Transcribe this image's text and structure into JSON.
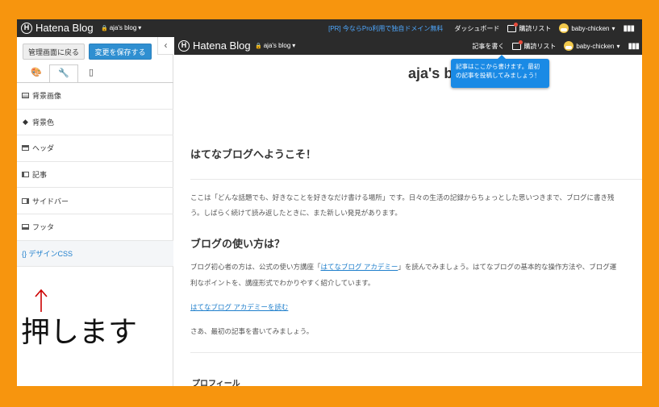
{
  "topbar": {
    "logo_text": "Hatena Blog",
    "blog_name": "aja's blog",
    "pr_text": "[PR] 今ならPro利用で独自ドメイン無料",
    "dashboard": "ダッシュボード",
    "reading_list": "購読リスト",
    "user": "baby-chicken"
  },
  "sidebar": {
    "back_button": "管理画面に戻る",
    "save_button": "変更を保存する",
    "collapse_glyph": "‹",
    "tabs": [
      {
        "icon": "palette-icon",
        "glyph": "🎨"
      },
      {
        "icon": "wrench-icon",
        "glyph": "🔧"
      },
      {
        "icon": "mobile-icon",
        "glyph": "▯"
      }
    ],
    "items": [
      {
        "label": "背景画像"
      },
      {
        "label": "背景色"
      },
      {
        "label": "ヘッダ"
      },
      {
        "label": "記事"
      },
      {
        "label": "サイドバー"
      },
      {
        "label": "フッタ"
      },
      {
        "label": "{} デザインCSS"
      }
    ],
    "annotation": "押します"
  },
  "preview": {
    "logo_text": "Hatena Blog",
    "blog_name": "aja's blog",
    "write_entry": "記事を書く",
    "reading_list": "購読リスト",
    "user": "baby-chicken",
    "blog_title": "aja's b",
    "tooltip": "記事はここから書けます。最初の記事を投稿してみましょう！",
    "welcome_heading": "はてなブログへようこそ！",
    "welcome_p1": "ここは「どんな話題でも、好きなことを好きなだけ書ける場所」です。日々の生活の記録からちょっとした思いつきまで、ブログに書き残",
    "welcome_p2": "う。しばらく続けて読み返したときに、また新しい発見があります。",
    "howto_heading": "ブログの使い方は？",
    "howto_p1_pre": "ブログ初心者の方は、公式の使い方講座「",
    "howto_p1_link": "はてなブログ アカデミー",
    "howto_p1_post": "」を読んでみましょう。はてなブログの基本的な操作方法や、ブログ運",
    "howto_p2": "利なポイントを、講座形式でわかりやすく紹介しています。",
    "academy_link": "はてなブログ アカデミーを読む",
    "closing": "さあ、最初の記事を書いてみましょう。",
    "profile": "プロフィール"
  },
  "colors": {
    "frame": "#f7950e",
    "topbar": "#2b2b2b",
    "accent": "#2f8fd1",
    "annotation_arrow": "#cc0000"
  }
}
